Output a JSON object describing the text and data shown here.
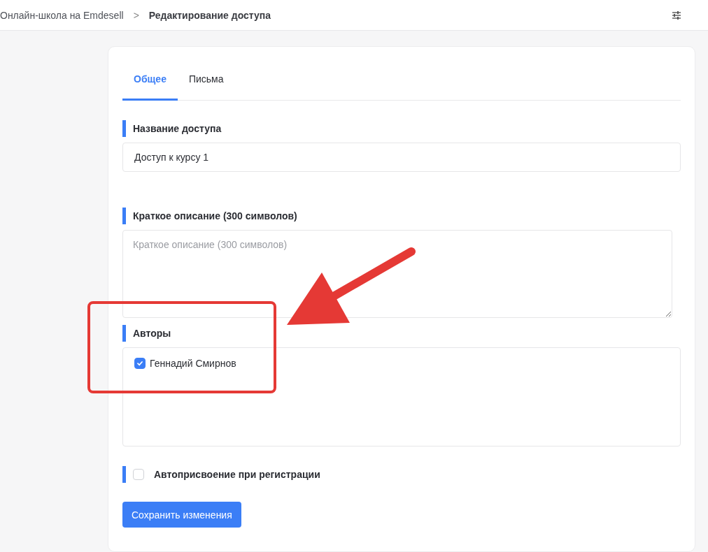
{
  "breadcrumb": {
    "parent": "Онлайн-школа на Emdesell",
    "separator": ">",
    "current": "Редактирование доступа"
  },
  "tabs": [
    {
      "label": "Общее",
      "selected": true
    },
    {
      "label": "Письма",
      "selected": false
    }
  ],
  "access_name": {
    "label": "Название доступа",
    "value": "Доступ к курсу 1"
  },
  "description": {
    "label": "Краткое описание (300 символов)",
    "placeholder": "Краткое описание (300 символов)"
  },
  "authors": {
    "label": "Авторы",
    "items": [
      {
        "name": "Геннадий Смирнов",
        "checked": true
      }
    ]
  },
  "auto_assign": {
    "label": "Автоприсвоение при регистрации",
    "checked": false
  },
  "save_button": "Сохранить изменения"
}
